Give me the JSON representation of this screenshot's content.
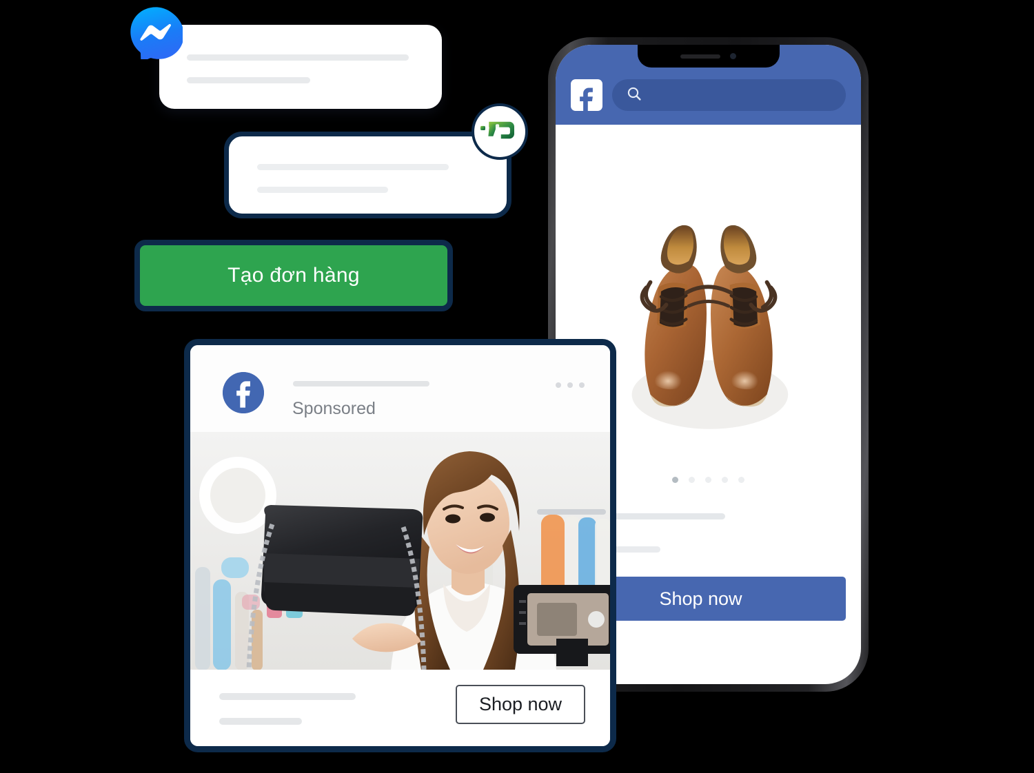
{
  "scene": {
    "background_color": "#000000",
    "accent_green": "#2ea44f",
    "accent_navy": "#0d2a4a",
    "facebook_blue": "#4767b0",
    "messenger_blue": "#0a7cff"
  },
  "messenger": {
    "icon_name": "messenger-icon"
  },
  "chat_bubbles": [
    {
      "id": "bubble-1",
      "lines": 2,
      "has_border": false
    },
    {
      "id": "bubble-2",
      "lines": 2,
      "has_border": true
    }
  ],
  "brand_badge": {
    "icon_name": "brand-logo-icon",
    "gradient_from": "#7ab648",
    "gradient_to": "#0d6b3f"
  },
  "cta": {
    "create_order_label": "Tạo đơn hàng"
  },
  "ad_card": {
    "page_name_placeholder": "",
    "sponsored_label": "Sponsored",
    "menu_icon": "more-options-icon",
    "avatar_icon": "facebook-logo-icon",
    "media_alt": "woman livestreaming with black handbag",
    "shop_button_label": "Shop now"
  },
  "phone": {
    "header": {
      "logo_icon": "facebook-logo-icon",
      "search_icon": "search-icon",
      "search_placeholder": ""
    },
    "product": {
      "media_alt": "pair of brown leather derby shoes",
      "carousel_dots": 5,
      "carousel_active_index": 0
    },
    "footer": {
      "shop_button_label": "Shop now"
    }
  }
}
